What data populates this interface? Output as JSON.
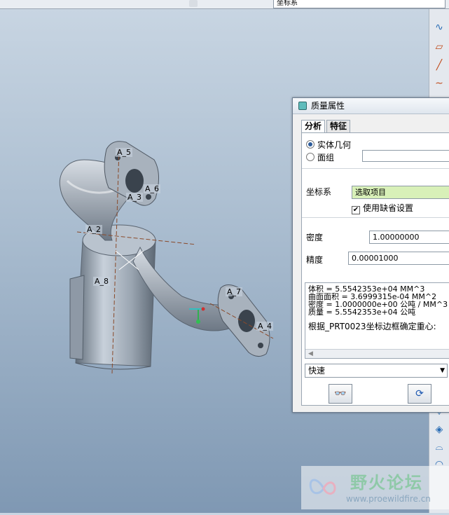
{
  "topbar": {
    "field_text": "坐标系"
  },
  "dialog": {
    "title": "质量属性",
    "tabs": [
      {
        "label": "分析"
      },
      {
        "label": "特征"
      }
    ],
    "geometry_options": {
      "solid": "实体几何",
      "quilt": "面组"
    },
    "coord_label": "坐标系",
    "coord_value": "选取项目",
    "use_default_label": "使用缺省设置",
    "density_label": "密度",
    "density_value": "1.00000000",
    "accuracy_label": "精度",
    "accuracy_value": "0.00001000",
    "results": [
      "体积 =  5.5542353e+04  MM^3",
      "曲面面积 =  3.6999315e-04  MM^2",
      "密度 =  1.0000000e+00 公吨 / MM^3",
      "质量 =  5.5542353e+04 公吨",
      "",
      "根据_PRT0023坐标边框确定重心:"
    ],
    "mode_value": "快速"
  },
  "model_labels": [
    "A_5",
    "A_6",
    "A_3",
    "A_2",
    "A_8",
    "A_7",
    "A_4"
  ],
  "watermark": {
    "name": "野火论坛",
    "url": "www.proewildfire.cn"
  }
}
